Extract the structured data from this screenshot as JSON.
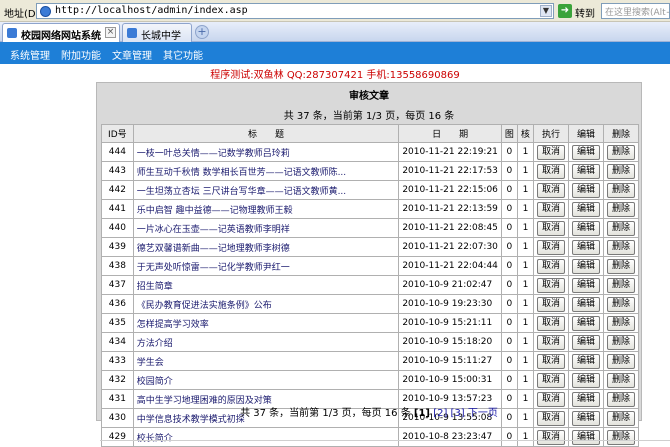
{
  "browser": {
    "address_label": "地址(D)",
    "url": "http://localhost/admin/index.asp",
    "go_label": "转到",
    "search_placeholder": "在这里搜索(Alt+",
    "tabs": [
      {
        "label": "校园网络网站系统"
      },
      {
        "label": "长城中学"
      }
    ]
  },
  "menu": [
    "系统管理",
    "附加功能",
    "文章管理",
    "其它功能"
  ],
  "notice": "程序测试:双鱼林 QQ:287307421 手机:13558690869",
  "panel": {
    "title": "审核文章",
    "summary": "共 37 条，当前第 1/3 页，每页 16 条",
    "headers": [
      "ID号",
      "标　　题",
      "日　　期",
      "图",
      "核",
      "执行",
      "编辑",
      "删除"
    ],
    "rows": [
      {
        "id": "444",
        "title": "一枝一叶总关情——记数学教师吕玲莉",
        "date": "2010-11-21 22:19:21",
        "img": "0",
        "check": "1",
        "exec": "取消",
        "edit": "编辑",
        "del": "删除"
      },
      {
        "id": "443",
        "title": "师生互动千秋情 数学相长百世芳——记语文教师陈...",
        "date": "2010-11-21 22:17:53",
        "img": "0",
        "check": "1",
        "exec": "取消",
        "edit": "编辑",
        "del": "删除"
      },
      {
        "id": "442",
        "title": "一生坦荡立杏坛 三尺讲台写华章——记语文教师黄...",
        "date": "2010-11-21 22:15:06",
        "img": "0",
        "check": "1",
        "exec": "取消",
        "edit": "编辑",
        "del": "删除"
      },
      {
        "id": "441",
        "title": "乐中启智 趣中益德——记物理教师王毅",
        "date": "2010-11-21 22:13:59",
        "img": "0",
        "check": "1",
        "exec": "取消",
        "edit": "编辑",
        "del": "删除"
      },
      {
        "id": "440",
        "title": "一片冰心在玉壶——记英语教师李明祥",
        "date": "2010-11-21 22:08:45",
        "img": "0",
        "check": "1",
        "exec": "取消",
        "edit": "编辑",
        "del": "删除"
      },
      {
        "id": "439",
        "title": "德艺双馨谱新曲——记地理教师李树德",
        "date": "2010-11-21 22:07:30",
        "img": "0",
        "check": "1",
        "exec": "取消",
        "edit": "编辑",
        "del": "删除"
      },
      {
        "id": "438",
        "title": "于无声处听惊雷——记化学教师尹红一",
        "date": "2010-11-21 22:04:44",
        "img": "0",
        "check": "1",
        "exec": "取消",
        "edit": "编辑",
        "del": "删除"
      },
      {
        "id": "437",
        "title": "招生简章",
        "date": "2010-10-9 21:02:47",
        "img": "0",
        "check": "1",
        "exec": "取消",
        "edit": "编辑",
        "del": "删除"
      },
      {
        "id": "436",
        "title": "《民办教育促进法实施条例》公布",
        "date": "2010-10-9 19:23:30",
        "img": "0",
        "check": "1",
        "exec": "取消",
        "edit": "编辑",
        "del": "删除"
      },
      {
        "id": "435",
        "title": "怎样提高学习效率",
        "date": "2010-10-9 15:21:11",
        "img": "0",
        "check": "1",
        "exec": "取消",
        "edit": "编辑",
        "del": "删除"
      },
      {
        "id": "434",
        "title": "方法介绍",
        "date": "2010-10-9 15:18:20",
        "img": "0",
        "check": "1",
        "exec": "取消",
        "edit": "编辑",
        "del": "删除"
      },
      {
        "id": "433",
        "title": "学生会",
        "date": "2010-10-9 15:11:27",
        "img": "0",
        "check": "1",
        "exec": "取消",
        "edit": "编辑",
        "del": "删除"
      },
      {
        "id": "432",
        "title": "校园简介",
        "date": "2010-10-9 15:00:31",
        "img": "0",
        "check": "1",
        "exec": "取消",
        "edit": "编辑",
        "del": "删除"
      },
      {
        "id": "431",
        "title": "高中生学习地理困难的原因及对策",
        "date": "2010-10-9 13:57:23",
        "img": "0",
        "check": "1",
        "exec": "取消",
        "edit": "编辑",
        "del": "删除"
      },
      {
        "id": "430",
        "title": "中学信息技术教学模式初探",
        "date": "2010-10-9 13:55:08",
        "img": "0",
        "check": "1",
        "exec": "取消",
        "edit": "编辑",
        "del": "删除"
      },
      {
        "id": "429",
        "title": "校长简介",
        "date": "2010-10-8 23:23:47",
        "img": "0",
        "check": "1",
        "exec": "取消",
        "edit": "编辑",
        "del": "删除"
      }
    ],
    "pager": {
      "prefix": "共 37 条，当前第 1/3 页，每页 16 条",
      "current": "[1]",
      "page2": "[2]",
      "page3": "[3]",
      "next": "下一页"
    }
  }
}
